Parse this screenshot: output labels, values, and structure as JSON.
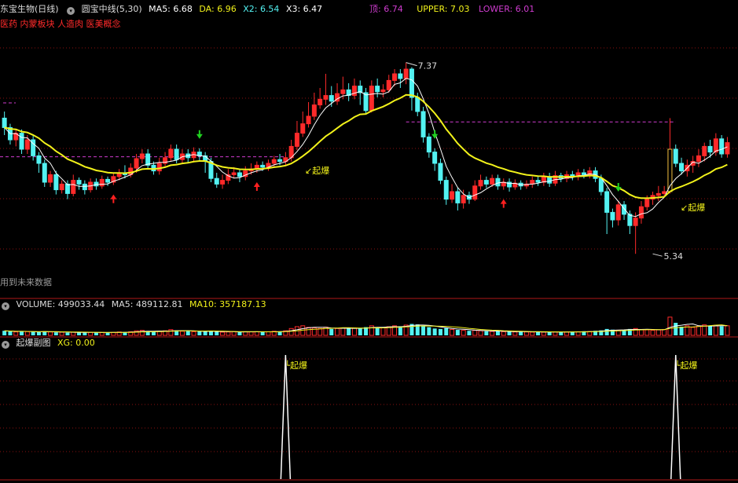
{
  "main_header": {
    "stock": "东宝生物(日线)",
    "indicator": "圆宝中线(5,30)",
    "ma5": "MA5: 6.68",
    "da": "DA: 6.96",
    "x2": "X2: 6.54",
    "x3": "X3: 6.47",
    "top": "顶: 6.74",
    "upper": "UPPER: 7.03",
    "lower": "LOWER: 6.01"
  },
  "concept_line": "医药 内蒙板块 人造肉 医美概念",
  "future_data_note": "用到未来数据",
  "annotations": {
    "high_label": "7.37",
    "low_label": "5.34",
    "qibao": "起爆"
  },
  "volume_header": {
    "volume": "VOLUME: 499033.44",
    "ma5": "MA5: 489112.81",
    "ma10": "MA10: 357187.13"
  },
  "sub_header": {
    "title": "起爆副图",
    "xg": "XG: 0.00"
  },
  "colors": {
    "up": "#ff2a2a",
    "down": "#53f2f2",
    "ma_white": "#ffffff",
    "ma_yellow": "#f2f21a",
    "dash_magenta": "#d03cd0",
    "grid_red": "#8a1010",
    "arrow_up": "#ff2020",
    "arrow_down": "#20d020"
  },
  "chart_data": [
    {
      "type": "candlestick",
      "title": "东宝生物(日线)",
      "series": "price",
      "ylim": [
        5.2,
        7.45
      ],
      "candles": [
        [
          6.78,
          6.68,
          6.85,
          6.6
        ],
        [
          6.68,
          6.55,
          6.72,
          6.5
        ],
        [
          6.55,
          6.62,
          6.66,
          6.48
        ],
        [
          6.62,
          6.45,
          6.66,
          6.4
        ],
        [
          6.45,
          6.55,
          6.6,
          6.4
        ],
        [
          6.55,
          6.38,
          6.6,
          6.33
        ],
        [
          6.38,
          6.3,
          6.42,
          6.2
        ],
        [
          6.3,
          6.1,
          6.34,
          6.05
        ],
        [
          6.1,
          6.18,
          6.22,
          6.05
        ],
        [
          6.18,
          6.02,
          6.22,
          5.97
        ],
        [
          6.02,
          6.08,
          6.12,
          5.98
        ],
        [
          6.08,
          5.98,
          6.12,
          5.92
        ],
        [
          5.98,
          6.12,
          6.18,
          5.95
        ],
        [
          6.12,
          6.08,
          6.15,
          6.02
        ],
        [
          6.08,
          6.02,
          6.12,
          5.97
        ],
        [
          6.02,
          6.1,
          6.14,
          5.99
        ],
        [
          6.1,
          6.06,
          6.14,
          6.02
        ],
        [
          6.06,
          6.13,
          6.17,
          6.03
        ],
        [
          6.13,
          6.1,
          6.16,
          6.06
        ],
        [
          6.1,
          6.16,
          6.2,
          6.07
        ],
        [
          6.16,
          6.2,
          6.24,
          6.12
        ],
        [
          6.2,
          6.18,
          6.28,
          6.14
        ],
        [
          6.18,
          6.25,
          6.3,
          6.15
        ],
        [
          6.25,
          6.35,
          6.4,
          6.2
        ],
        [
          6.35,
          6.4,
          6.45,
          6.3
        ],
        [
          6.4,
          6.28,
          6.45,
          6.24
        ],
        [
          6.28,
          6.22,
          6.32,
          6.18
        ],
        [
          6.22,
          6.3,
          6.36,
          6.18
        ],
        [
          6.3,
          6.36,
          6.42,
          6.26
        ],
        [
          6.36,
          6.45,
          6.5,
          6.32
        ],
        [
          6.45,
          6.34,
          6.5,
          6.3
        ],
        [
          6.34,
          6.4,
          6.45,
          6.3
        ],
        [
          6.4,
          6.36,
          6.45,
          6.3
        ],
        [
          6.36,
          6.42,
          6.47,
          6.32
        ],
        [
          6.42,
          6.38,
          6.46,
          6.33
        ],
        [
          6.38,
          6.32,
          6.42,
          6.2
        ],
        [
          6.32,
          6.14,
          6.36,
          6.1
        ],
        [
          6.14,
          6.08,
          6.2,
          6.04
        ],
        [
          6.08,
          6.12,
          6.18,
          6.03
        ],
        [
          6.12,
          6.18,
          6.24,
          6.08
        ],
        [
          6.18,
          6.2,
          6.26,
          6.14
        ],
        [
          6.2,
          6.16,
          6.24,
          6.1
        ],
        [
          6.16,
          6.22,
          6.27,
          6.12
        ],
        [
          6.22,
          6.24,
          6.3,
          6.18
        ],
        [
          6.24,
          6.28,
          6.32,
          6.2
        ],
        [
          6.28,
          6.26,
          6.32,
          6.22
        ],
        [
          6.26,
          6.3,
          6.34,
          6.22
        ],
        [
          6.3,
          6.34,
          6.38,
          6.26
        ],
        [
          6.34,
          6.32,
          6.4,
          6.28
        ],
        [
          6.32,
          6.36,
          6.42,
          6.28
        ],
        [
          6.36,
          6.48,
          6.55,
          6.32
        ],
        [
          6.48,
          6.62,
          6.75,
          6.44
        ],
        [
          6.62,
          6.72,
          6.85,
          6.58
        ],
        [
          6.72,
          6.8,
          6.95,
          6.68
        ],
        [
          6.8,
          6.92,
          7.05,
          6.76
        ],
        [
          6.92,
          6.98,
          7.1,
          6.88
        ],
        [
          6.98,
          7.02,
          7.25,
          6.92
        ],
        [
          7.02,
          6.96,
          7.12,
          6.9
        ],
        [
          6.96,
          7.04,
          7.15,
          6.92
        ],
        [
          7.04,
          7.08,
          7.22,
          6.98
        ],
        [
          7.08,
          7.02,
          7.15,
          6.96
        ],
        [
          7.02,
          7.12,
          7.2,
          6.98
        ],
        [
          7.12,
          7.05,
          7.18,
          6.92
        ],
        [
          7.05,
          6.86,
          7.1,
          6.82
        ],
        [
          6.86,
          7.12,
          7.18,
          6.84
        ],
        [
          7.12,
          7.06,
          7.2,
          7.0
        ],
        [
          7.06,
          7.08,
          7.14,
          7.0
        ],
        [
          7.08,
          7.18,
          7.24,
          7.05
        ],
        [
          7.18,
          7.25,
          7.3,
          7.12
        ],
        [
          7.25,
          7.2,
          7.3,
          7.1
        ],
        [
          7.2,
          7.3,
          7.37,
          7.14
        ],
        [
          7.3,
          7.0,
          7.32,
          6.86
        ],
        [
          7.0,
          6.85,
          7.05,
          6.8
        ],
        [
          6.85,
          6.58,
          6.9,
          6.52
        ],
        [
          6.58,
          6.42,
          6.62,
          6.36
        ],
        [
          6.42,
          6.3,
          6.46,
          6.22
        ],
        [
          6.3,
          6.12,
          6.35,
          6.08
        ],
        [
          6.12,
          5.92,
          6.16,
          5.86
        ],
        [
          5.92,
          6.0,
          6.08,
          5.88
        ],
        [
          6.0,
          5.88,
          6.04,
          5.8
        ],
        [
          5.88,
          5.96,
          6.02,
          5.82
        ],
        [
          5.96,
          5.92,
          6.0,
          5.87
        ],
        [
          5.92,
          6.06,
          6.12,
          5.9
        ],
        [
          6.06,
          6.12,
          6.18,
          6.02
        ],
        [
          6.12,
          6.08,
          6.16,
          6.04
        ],
        [
          6.08,
          6.14,
          6.18,
          6.05
        ],
        [
          6.14,
          6.06,
          6.18,
          6.02
        ],
        [
          6.06,
          6.1,
          6.14,
          6.02
        ],
        [
          6.1,
          6.05,
          6.14,
          6.0
        ],
        [
          6.05,
          6.09,
          6.13,
          6.02
        ],
        [
          6.09,
          6.06,
          6.12,
          6.02
        ],
        [
          6.06,
          6.08,
          6.12,
          6.03
        ],
        [
          6.08,
          6.12,
          6.16,
          6.04
        ],
        [
          6.12,
          6.1,
          6.16,
          6.06
        ],
        [
          6.1,
          6.16,
          6.2,
          6.06
        ],
        [
          6.16,
          6.09,
          6.2,
          6.05
        ],
        [
          6.09,
          6.17,
          6.22,
          6.06
        ],
        [
          6.17,
          6.14,
          6.2,
          6.1
        ],
        [
          6.14,
          6.18,
          6.22,
          6.1
        ],
        [
          6.18,
          6.16,
          6.22,
          6.12
        ],
        [
          6.16,
          6.2,
          6.24,
          6.12
        ],
        [
          6.2,
          6.18,
          6.24,
          6.14
        ],
        [
          6.18,
          6.22,
          6.26,
          6.14
        ],
        [
          6.22,
          6.14,
          6.26,
          6.1
        ],
        [
          6.14,
          6.0,
          6.18,
          5.96
        ],
        [
          6.0,
          5.78,
          6.04,
          5.55
        ],
        [
          5.78,
          5.7,
          5.82,
          5.62
        ],
        [
          5.7,
          5.86,
          5.9,
          5.64
        ],
        [
          5.86,
          5.76,
          5.9,
          5.7
        ],
        [
          5.76,
          5.64,
          5.8,
          5.55
        ],
        [
          5.64,
          5.72,
          5.78,
          5.34
        ],
        [
          5.72,
          5.84,
          5.9,
          5.66
        ],
        [
          5.84,
          5.92,
          5.96,
          5.8
        ],
        [
          5.92,
          5.96,
          6.0,
          5.86
        ],
        [
          5.96,
          5.98,
          6.06,
          5.9
        ],
        [
          5.98,
          6.0,
          6.06,
          5.94
        ],
        [
          6.0,
          6.45,
          6.78,
          5.98
        ],
        [
          6.45,
          6.3,
          6.5,
          6.26
        ],
        [
          6.3,
          6.22,
          6.36,
          6.18
        ],
        [
          6.22,
          6.28,
          6.34,
          6.16
        ],
        [
          6.28,
          6.32,
          6.38,
          6.2
        ],
        [
          6.32,
          6.38,
          6.45,
          6.26
        ],
        [
          6.38,
          6.48,
          6.52,
          6.32
        ],
        [
          6.48,
          6.42,
          6.55,
          6.36
        ],
        [
          6.42,
          6.56,
          6.62,
          6.38
        ],
        [
          6.56,
          6.4,
          6.6,
          6.36
        ],
        [
          6.4,
          6.52,
          6.58,
          6.36
        ]
      ],
      "trend_dash_levels": [
        6.37,
        6.74
      ],
      "signals_up": [
        19,
        44,
        87
      ],
      "signals_down": [
        34,
        75,
        107
      ]
    },
    {
      "type": "bar",
      "title": "VOLUME",
      "ylim": [
        0,
        1
      ],
      "values": [
        0.2,
        0.18,
        0.15,
        0.17,
        0.16,
        0.16,
        0.14,
        0.18,
        0.15,
        0.13,
        0.14,
        0.12,
        0.14,
        0.12,
        0.12,
        0.13,
        0.12,
        0.13,
        0.12,
        0.13,
        0.15,
        0.14,
        0.16,
        0.2,
        0.22,
        0.18,
        0.16,
        0.18,
        0.2,
        0.25,
        0.22,
        0.18,
        0.19,
        0.16,
        0.17,
        0.18,
        0.2,
        0.16,
        0.14,
        0.15,
        0.16,
        0.15,
        0.16,
        0.15,
        0.16,
        0.15,
        0.16,
        0.18,
        0.17,
        0.2,
        0.3,
        0.38,
        0.42,
        0.35,
        0.33,
        0.3,
        0.36,
        0.28,
        0.3,
        0.32,
        0.3,
        0.33,
        0.3,
        0.36,
        0.42,
        0.35,
        0.33,
        0.38,
        0.42,
        0.4,
        0.45,
        0.5,
        0.48,
        0.42,
        0.36,
        0.3,
        0.28,
        0.32,
        0.26,
        0.24,
        0.22,
        0.2,
        0.22,
        0.2,
        0.18,
        0.17,
        0.18,
        0.16,
        0.17,
        0.15,
        0.16,
        0.15,
        0.14,
        0.15,
        0.14,
        0.16,
        0.15,
        0.14,
        0.15,
        0.16,
        0.16,
        0.18,
        0.17,
        0.2,
        0.22,
        0.28,
        0.25,
        0.22,
        0.24,
        0.28,
        0.3,
        0.26,
        0.24,
        0.22,
        0.24,
        0.26,
        0.8,
        0.55,
        0.38,
        0.42,
        0.35,
        0.4,
        0.46,
        0.42,
        0.44,
        0.4,
        0.42
      ]
    },
    {
      "type": "line",
      "title": "起爆副图",
      "ylim": [
        0,
        1
      ],
      "spikes": [
        49,
        117
      ]
    }
  ]
}
